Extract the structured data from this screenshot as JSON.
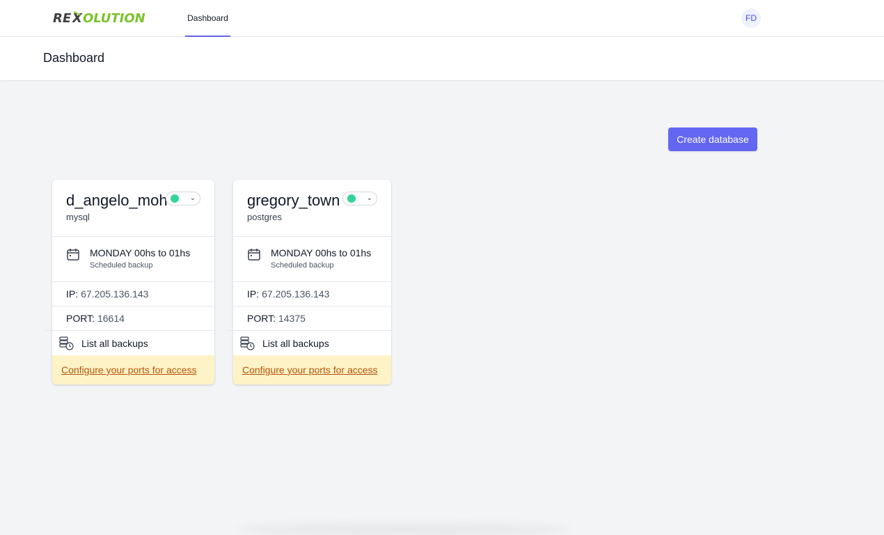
{
  "brand": {
    "logo_text": "REXOLUTION"
  },
  "nav": {
    "tabs": [
      {
        "label": "Dashboard",
        "active": true
      }
    ]
  },
  "user": {
    "initials": "FD"
  },
  "page": {
    "title": "Dashboard"
  },
  "actions": {
    "create_label": "Create database"
  },
  "colors": {
    "accent": "#6366f1",
    "status_online": "#34d399",
    "warning_bg": "#fef3c7",
    "warning_text": "#b45309"
  },
  "databases": [
    {
      "name": "d_angelo_moh",
      "engine": "mysql",
      "status": "online",
      "schedule": {
        "time": "MONDAY 00hs to 01hs",
        "label": "Scheduled backup"
      },
      "ip_label": "IP:",
      "ip": "67.205.136.143",
      "port_label": "PORT:",
      "port": "16614",
      "backups_label": "List all backups",
      "config_link": "Configure your ports for access"
    },
    {
      "name": "gregory_town",
      "engine": "postgres",
      "status": "online",
      "schedule": {
        "time": "MONDAY 00hs to 01hs",
        "label": "Scheduled backup"
      },
      "ip_label": "IP:",
      "ip": "67.205.136.143",
      "port_label": "PORT:",
      "port": "14375",
      "backups_label": "List all backups",
      "config_link": "Configure your ports for access"
    }
  ]
}
